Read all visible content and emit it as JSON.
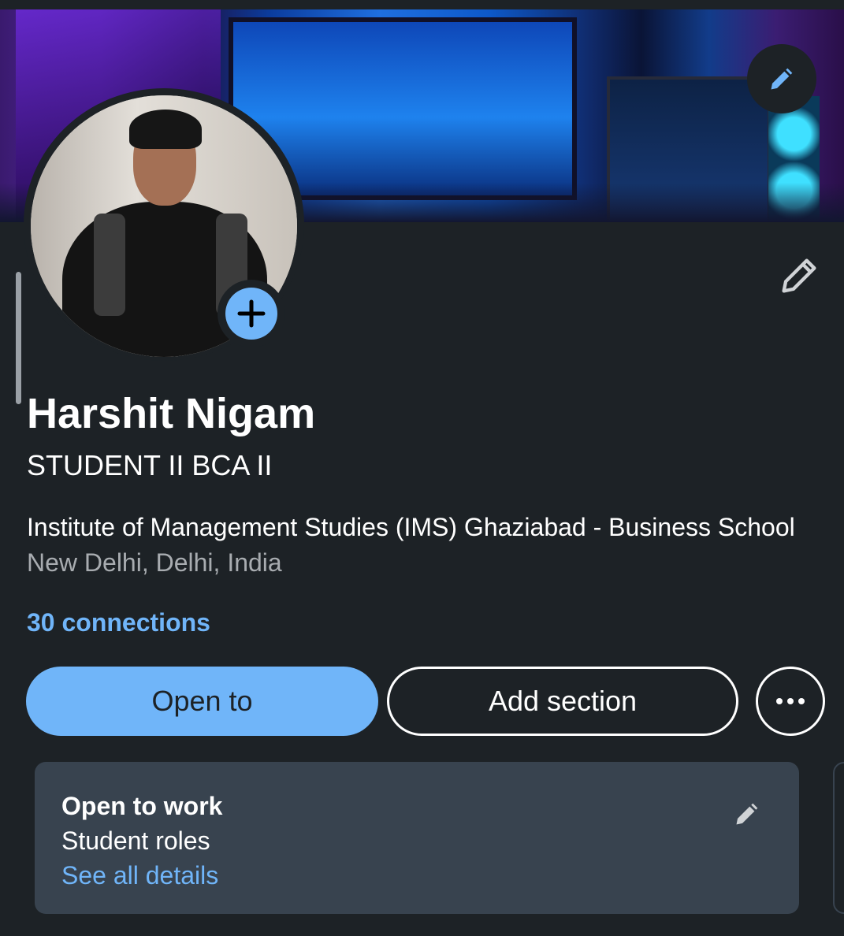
{
  "profile": {
    "name": "Harshit Nigam",
    "headline": "STUDENT II BCA II",
    "school": "Institute of Management Studies (IMS) Ghaziabad - Business School",
    "location": "New Delhi, Delhi, India",
    "connections": "30 connections"
  },
  "actions": {
    "open_to": "Open to",
    "add_section": "Add section",
    "more_icon": "more-horizontal-icon"
  },
  "open_to_work": {
    "title": "Open to work",
    "subtitle": "Student roles",
    "link": "See all details"
  },
  "icons": {
    "banner_edit": "pencil-icon",
    "intro_edit": "pencil-icon",
    "avatar_add": "plus-icon",
    "otw_edit": "pencil-icon"
  },
  "colors": {
    "background": "#1d2226",
    "accent": "#70b5f9",
    "card": "#38434f",
    "muted_text": "#a8acb0"
  }
}
